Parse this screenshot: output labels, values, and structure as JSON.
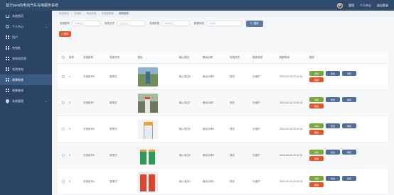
{
  "header": {
    "title": "基于java的电动汽车充电服务系统",
    "user_link": "管理",
    "profile_label": "个人中心",
    "logout_label": "退出登录"
  },
  "sidebar": {
    "items": [
      {
        "label": "系统首页",
        "icon": "home-icon",
        "active": false,
        "chevron": false
      },
      {
        "label": "个人中心",
        "icon": "user-circle-icon",
        "active": false,
        "chevron": true
      },
      {
        "label": "用户",
        "icon": "grid-icon",
        "active": false,
        "chevron": false
      },
      {
        "label": "充电桩",
        "icon": "grid-icon",
        "active": false,
        "chevron": false
      },
      {
        "label": "充电站信息",
        "icon": "grid-icon",
        "active": false,
        "chevron": false
      },
      {
        "label": "电池充电",
        "icon": "grid-icon",
        "active": false,
        "chevron": false
      },
      {
        "label": "故障报修",
        "icon": "grid-icon",
        "active": true,
        "chevron": false
      },
      {
        "label": "故障维修",
        "icon": "grid-icon",
        "active": false,
        "chevron": false
      },
      {
        "label": "系统管理",
        "icon": "pin-icon",
        "active": false,
        "chevron": true
      }
    ]
  },
  "breadcrumb": [
    "系统首页",
    "充电桩",
    "电池充电",
    "充电桩报修",
    "故障维修"
  ],
  "filters": {
    "code_label": "充电桩号",
    "code_placeholder": "充电桩号",
    "type_label": "充电方式",
    "type_placeholder": "充电方式",
    "name_label": "充电车型",
    "name_placeholder": "充电车型",
    "status_label": "报修状态",
    "status_placeholder": "请选择",
    "search_label": "搜索"
  },
  "actions": {
    "delete_label": "删除"
  },
  "table": {
    "headers": [
      "序号",
      "充电桩号",
      "充电方式",
      "图片",
      "输入电压",
      "输出功率",
      "充电方式",
      "报修状态",
      "报修时间",
      "操作"
    ],
    "rows": [
      {
        "no": "1",
        "code": "充电桩号8",
        "type": "常规式",
        "img": "t1",
        "iv": "输入电压8",
        "ov": "输出功率8",
        "mode": "快充",
        "status": "已维护",
        "time": "2024-04-16 22:41:51"
      },
      {
        "no": "2",
        "code": "充电桩号7",
        "type": "常规式",
        "img": "t2",
        "iv": "输入电压7",
        "ov": "输出功率7",
        "mode": "快充",
        "status": "已维护",
        "time": "2024-04-16 22:41:51"
      },
      {
        "no": "3",
        "code": "充电桩号6",
        "type": "常规式",
        "img": "t3",
        "iv": "输入电压6",
        "ov": "输出功率6",
        "mode": "快充",
        "status": "已维护",
        "time": "2024-04-16 22:41:51"
      },
      {
        "no": "4",
        "code": "充电桩号5",
        "type": "常规式",
        "img": "t4",
        "iv": "输入电压5",
        "ov": "输出功率5",
        "mode": "快充",
        "status": "已维护",
        "time": "2024-04-16 22:41:51"
      },
      {
        "no": "5",
        "code": "充电桩号4",
        "type": "常规式",
        "img": "t5",
        "iv": "输入电压4",
        "ov": "输出功率4",
        "mode": "快充",
        "status": "已维护",
        "time": "2024-04-16 22:41:51"
      }
    ],
    "op_labels": {
      "detail": "详情",
      "edit": "修改",
      "review": "审核",
      "delete": "删除"
    }
  },
  "colors": {
    "header_bg": "#2f4a6b",
    "sidebar_bg": "#2b4466",
    "accent": "#5b7ba5",
    "danger": "#e4572e",
    "success": "#7aa83c"
  }
}
